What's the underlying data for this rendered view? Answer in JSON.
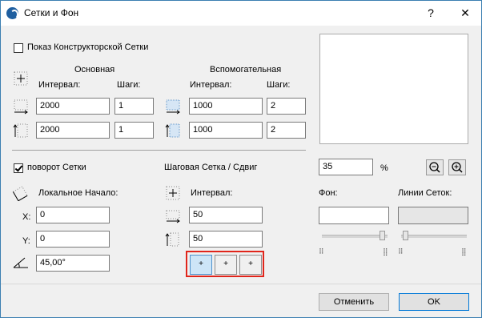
{
  "window": {
    "title": "Сетки и Фон",
    "help_label": "?",
    "close_label": "✕"
  },
  "construction_grid": {
    "checkbox_label": "Показ Конструкторской Сетки",
    "checked": false,
    "main": {
      "header": "Основная",
      "interval_label": "Интервал:",
      "steps_label": "Шаги:",
      "x_interval": "2000",
      "x_steps": "1",
      "y_interval": "2000",
      "y_steps": "1"
    },
    "aux": {
      "header": "Вспомогательная",
      "interval_label": "Интервал:",
      "steps_label": "Шаги:",
      "x_interval": "1000",
      "x_steps": "2",
      "y_interval": "1000",
      "y_steps": "2"
    }
  },
  "rotate": {
    "checkbox_label": "поворот Сетки",
    "checked": true,
    "origin_label": "Локальное Начало:",
    "x_label": "X:",
    "x_value": "0",
    "y_label": "Y:",
    "y_value": "0",
    "angle_value": "45,00°"
  },
  "snap": {
    "header": "Шаговая Сетка / Сдвиг",
    "interval_label": "Интервал:",
    "x_value": "50",
    "y_value": "50",
    "segments": [
      "+",
      "+",
      "+"
    ],
    "selected_segment": 0
  },
  "preview": {
    "zoom_value": "35",
    "zoom_unit": "%",
    "zoom_out": "−",
    "zoom_in": "+"
  },
  "colors": {
    "background_label": "Фон:",
    "grid_lines_label": "Линии Сеток:",
    "background_color": "#ffffff",
    "grid_lines_color": "#e6e6e6"
  },
  "buttons": {
    "cancel": "Отменить",
    "ok": "OK"
  }
}
